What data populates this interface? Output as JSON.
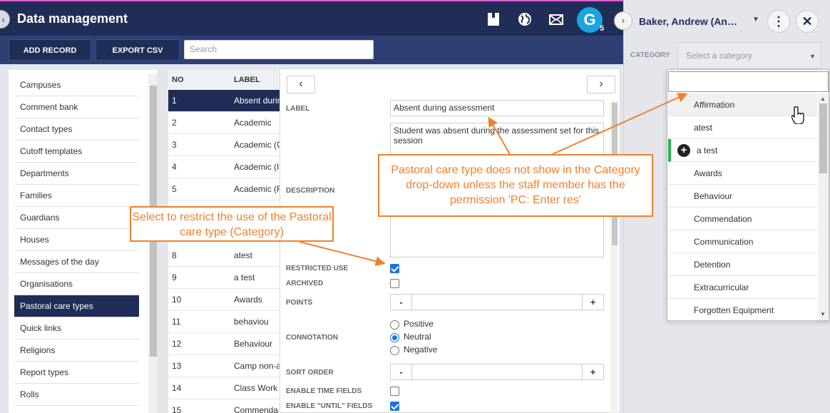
{
  "header": {
    "title": "Data management",
    "avatar_letter": "G",
    "avatar_badge": "5"
  },
  "toolbar": {
    "add_label": "ADD RECORD",
    "export_label": "EXPORT CSV",
    "search_placeholder": "Search"
  },
  "sidebar": {
    "items": [
      {
        "label": "Campuses"
      },
      {
        "label": "Comment bank"
      },
      {
        "label": "Contact types"
      },
      {
        "label": "Cutoff templates"
      },
      {
        "label": "Departments"
      },
      {
        "label": "Families"
      },
      {
        "label": "Guardians"
      },
      {
        "label": "Houses"
      },
      {
        "label": "Messages of the day"
      },
      {
        "label": "Organisations"
      },
      {
        "label": "Pastoral care types",
        "active": true
      },
      {
        "label": "Quick links"
      },
      {
        "label": "Religions"
      },
      {
        "label": "Report types"
      },
      {
        "label": "Rolls"
      }
    ]
  },
  "table": {
    "col_no": "NO",
    "col_label": "LABEL",
    "rows": [
      {
        "no": "1",
        "label": "Absent durin"
      },
      {
        "no": "2",
        "label": "Academic"
      },
      {
        "no": "3",
        "label": "Academic (C"
      },
      {
        "no": "4",
        "label": "Academic (I"
      },
      {
        "no": "5",
        "label": "Academic (F"
      },
      {
        "no": "8",
        "label": "atest"
      },
      {
        "no": "9",
        "label": "a test"
      },
      {
        "no": "10",
        "label": "Awards"
      },
      {
        "no": "11",
        "label": "behaviou"
      },
      {
        "no": "12",
        "label": "Behaviour"
      },
      {
        "no": "13",
        "label": "Camp non-a"
      },
      {
        "no": "14",
        "label": "Class Work"
      },
      {
        "no": "15",
        "label": "Commenda"
      }
    ]
  },
  "form": {
    "prev": "‹",
    "next": "›",
    "label_caption": "LABEL",
    "label_value": "Absent during assessment",
    "description_caption": "DESCRIPTION",
    "description_value": "Student was absent during the assessment set for this session",
    "restricted_caption": "RESTRICTED USE",
    "archived_caption": "ARCHIVED",
    "points_caption": "POINTS",
    "connotation_caption": "CONNOTATION",
    "connotation_options": [
      "Positive",
      "Neutral",
      "Negative"
    ],
    "sort_caption": "SORT ORDER",
    "time_fields_caption": "ENABLE TIME FIELDS",
    "until_fields_caption": "ENABLE \"UNTIL\" FIELDS",
    "minus": "-",
    "plus": "+"
  },
  "right_panel": {
    "student_name": "Baker, Andrew (An…",
    "category_caption": "CATEGORY",
    "category_placeholder": "Select a category",
    "dropdown_items": [
      "Affirmation",
      "atest",
      "a test",
      "Awards",
      "Behaviour",
      "Commendation",
      "Communication",
      "Detention",
      "Extracurricular",
      "Forgotten Equipment"
    ]
  },
  "callouts": {
    "restrict": "Select to restrict the use of the Pastoral care type (Category)",
    "permission": "Pastoral care type does not show in the Category drop-down unless the staff member has the permission 'PC: Enter res'"
  },
  "colors": {
    "navy": "#1f2d57",
    "accent_blue": "#1a73e8",
    "callout_orange": "#f0812b",
    "avatar_blue": "#1aa4e0"
  }
}
